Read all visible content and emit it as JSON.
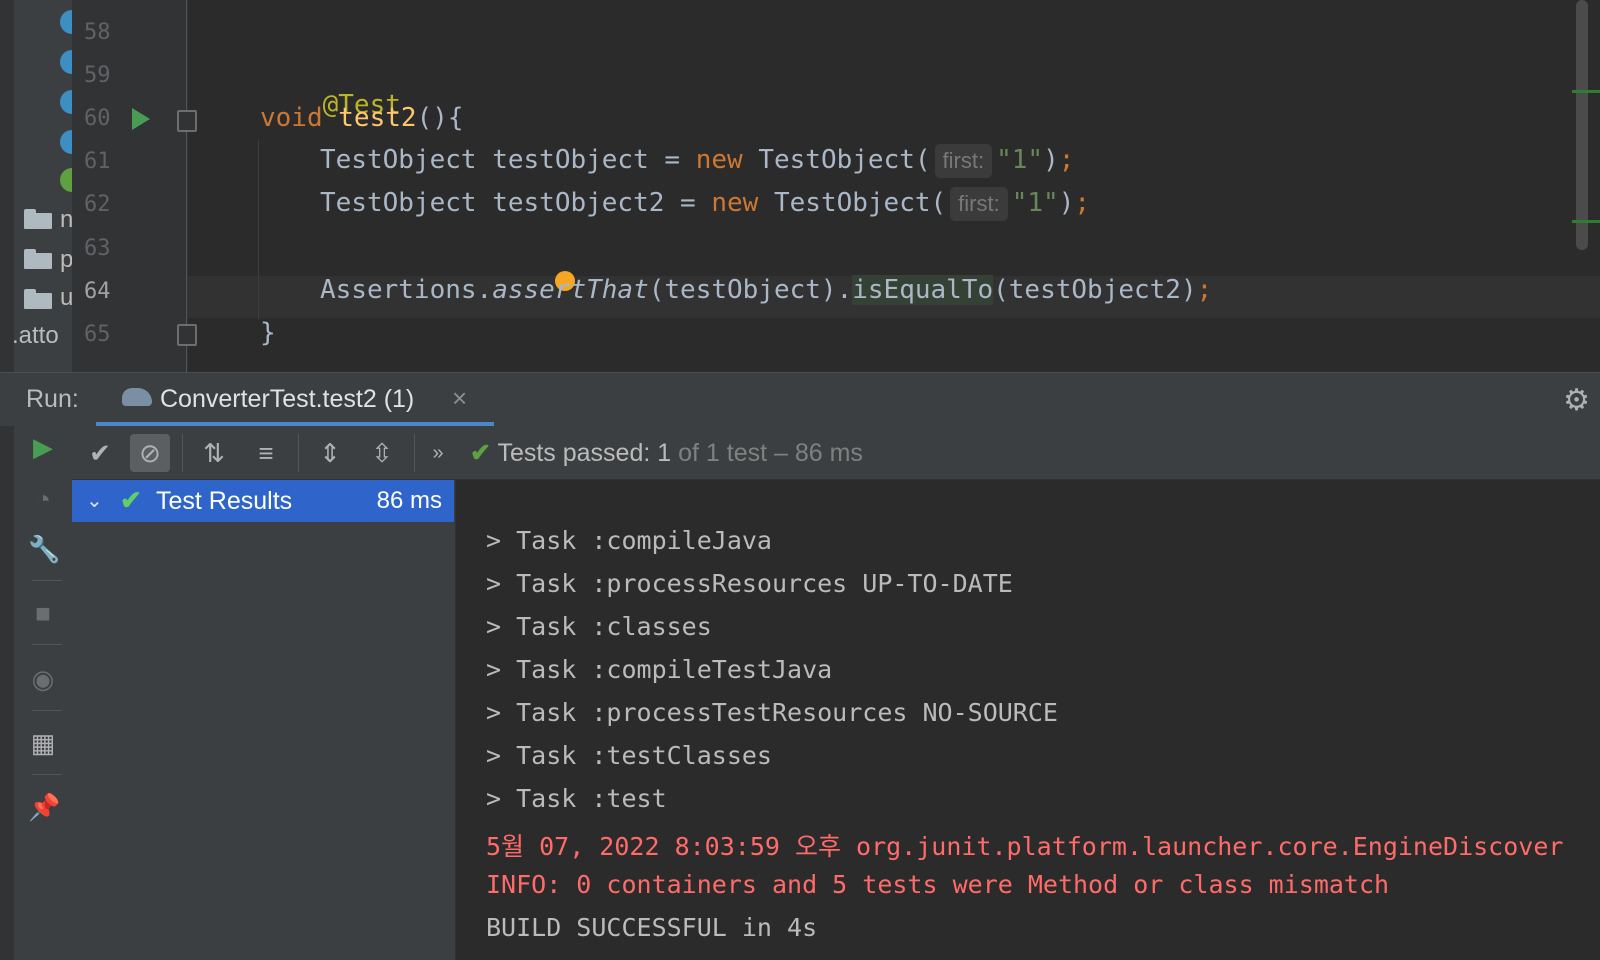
{
  "project": {
    "folders": [
      {
        "label": "n"
      },
      {
        "label": "p"
      },
      {
        "label": "u"
      }
    ],
    "file_fragment": ".atto"
  },
  "editor": {
    "lines": [
      {
        "num": "58"
      },
      {
        "num": "59",
        "annotation": "@Test"
      },
      {
        "num": "60",
        "kw": "void",
        "fn": "test2",
        "rest": "(){"
      },
      {
        "num": "61",
        "type": "TestObject",
        "var": "testObject",
        "eq": " = ",
        "kw": "new",
        "ctor": "TestObject(",
        "hint": "first:",
        "str": "\"1\"",
        "close": ")",
        "semi": ";"
      },
      {
        "num": "62",
        "type": "TestObject",
        "var": "testObject2",
        "eq": " = ",
        "kw": "new",
        "ctor": "TestObject(",
        "hint": "first:",
        "str": "\"1\"",
        "close": ")",
        "semi": ";"
      },
      {
        "num": "63"
      },
      {
        "num": "64",
        "cls": "Assertions.",
        "method": "assertThat",
        "arg": "(testObject).",
        "method2": "isEqualTo",
        "arg2": "(testObject2)",
        "semi": ";"
      },
      {
        "num": "65",
        "brace": "}"
      }
    ]
  },
  "run": {
    "label": "Run:",
    "tab_title": "ConverterTest.test2 (1)",
    "close_icon": "×",
    "status": {
      "passed": "Tests passed: 1",
      "rest": " of 1 test – 86 ms"
    },
    "tree": {
      "root_label": "Test Results",
      "root_time": "86 ms"
    },
    "console": [
      {
        "text": "> Task :compileJava",
        "type": "normal"
      },
      {
        "text": "> Task :processResources UP-TO-DATE",
        "type": "normal"
      },
      {
        "text": "> Task :classes",
        "type": "normal"
      },
      {
        "text": "> Task :compileTestJava",
        "type": "normal"
      },
      {
        "text": "> Task :processTestResources NO-SOURCE",
        "type": "normal"
      },
      {
        "text": "> Task :testClasses",
        "type": "normal"
      },
      {
        "text": "> Task :test",
        "type": "normal"
      },
      {
        "text": "5월 07, 2022 8:03:59 오후 org.junit.platform.launcher.core.EngineDiscover",
        "type": "error"
      },
      {
        "text": "INFO: 0 containers and 5 tests were Method or class mismatch",
        "type": "error"
      },
      {
        "text": "BUILD SUCCESSFUL in 4s",
        "type": "normal"
      }
    ]
  },
  "colors": {
    "accent": "#4a88c7",
    "selection": "#2f65ca",
    "success": "#5fa040",
    "error": "#ff6b68",
    "keyword": "#cc7832",
    "function": "#ffc66d",
    "annotation": "#bbb529",
    "string": "#6a8759"
  },
  "icons": {
    "toolbar": [
      "rerun-icon",
      "show-passed-icon",
      "show-ignored-icon",
      "sort-alpha-icon",
      "sort-duration-icon",
      "expand-all-icon",
      "collapse-all-icon",
      "more-icon"
    ],
    "side": [
      "run-icon",
      "debug-icon",
      "wrench-icon",
      "stop-icon",
      "eye-icon",
      "layout-icon",
      "pin-icon"
    ]
  }
}
